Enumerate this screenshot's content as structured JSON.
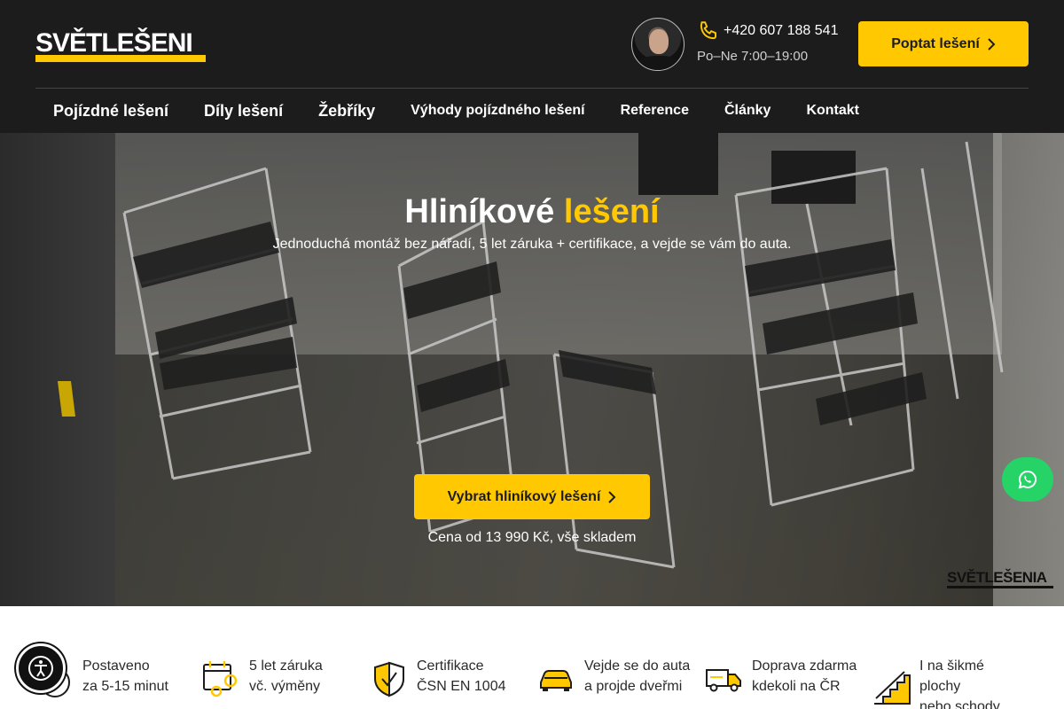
{
  "header": {
    "logo": {
      "line": "SVĚTLEŠENI",
      "brand_color": "#ffc800"
    },
    "contact": {
      "phone": "+420 607 188 541",
      "hours": "Po–Ne 7:00–19:00",
      "phone_icon": "phone-icon"
    },
    "cta_label": "Poptat lešení"
  },
  "nav": {
    "items": [
      {
        "label": "Pojízdné lešení"
      },
      {
        "label": "Díly lešení"
      },
      {
        "label": "Žebříky"
      },
      {
        "label": "Výhody pojízdného lešení"
      },
      {
        "label": "Reference"
      },
      {
        "label": "Články"
      },
      {
        "label": "Kontakt"
      }
    ]
  },
  "hero": {
    "title_main": "Hliníkové",
    "title_accent": "lešení",
    "subtitle": "Jednoduchá montáž bez nářadí, 5 let záruka + certifikace, a vejde se vám do auta.",
    "cta_label": "Vybrat hliníkový lešení",
    "price_note": "Cena od 13 990 Kč, vše skladem",
    "watermark": "SVĚTLEŠENIA"
  },
  "features": [
    {
      "icon": "clock-icon",
      "line1": "Postaveno",
      "line2": "za 5-15 minut"
    },
    {
      "icon": "calendar-gear-icon",
      "line1": "5 let záruka",
      "line2": "vč. výměny"
    },
    {
      "icon": "shield-check-icon",
      "line1": "Certifikace",
      "line2": "ČSN EN 1004"
    },
    {
      "icon": "car-icon",
      "line1": "Vejde se do auta",
      "line2": "a projde dveřmi"
    },
    {
      "icon": "truck-icon",
      "line1": "Doprava zdarma",
      "line2": "kdekoli na ČR"
    },
    {
      "icon": "stairs-icon",
      "line1": "I na šikmé",
      "line2": "plochy",
      "line3": "nebo schody"
    }
  ],
  "floating": {
    "whatsapp_icon": "whatsapp-icon",
    "accessibility_icon": "accessibility-icon"
  },
  "colors": {
    "accent": "#ffc800",
    "header_bg": "#1c1c1c",
    "whatsapp": "#25d366"
  }
}
